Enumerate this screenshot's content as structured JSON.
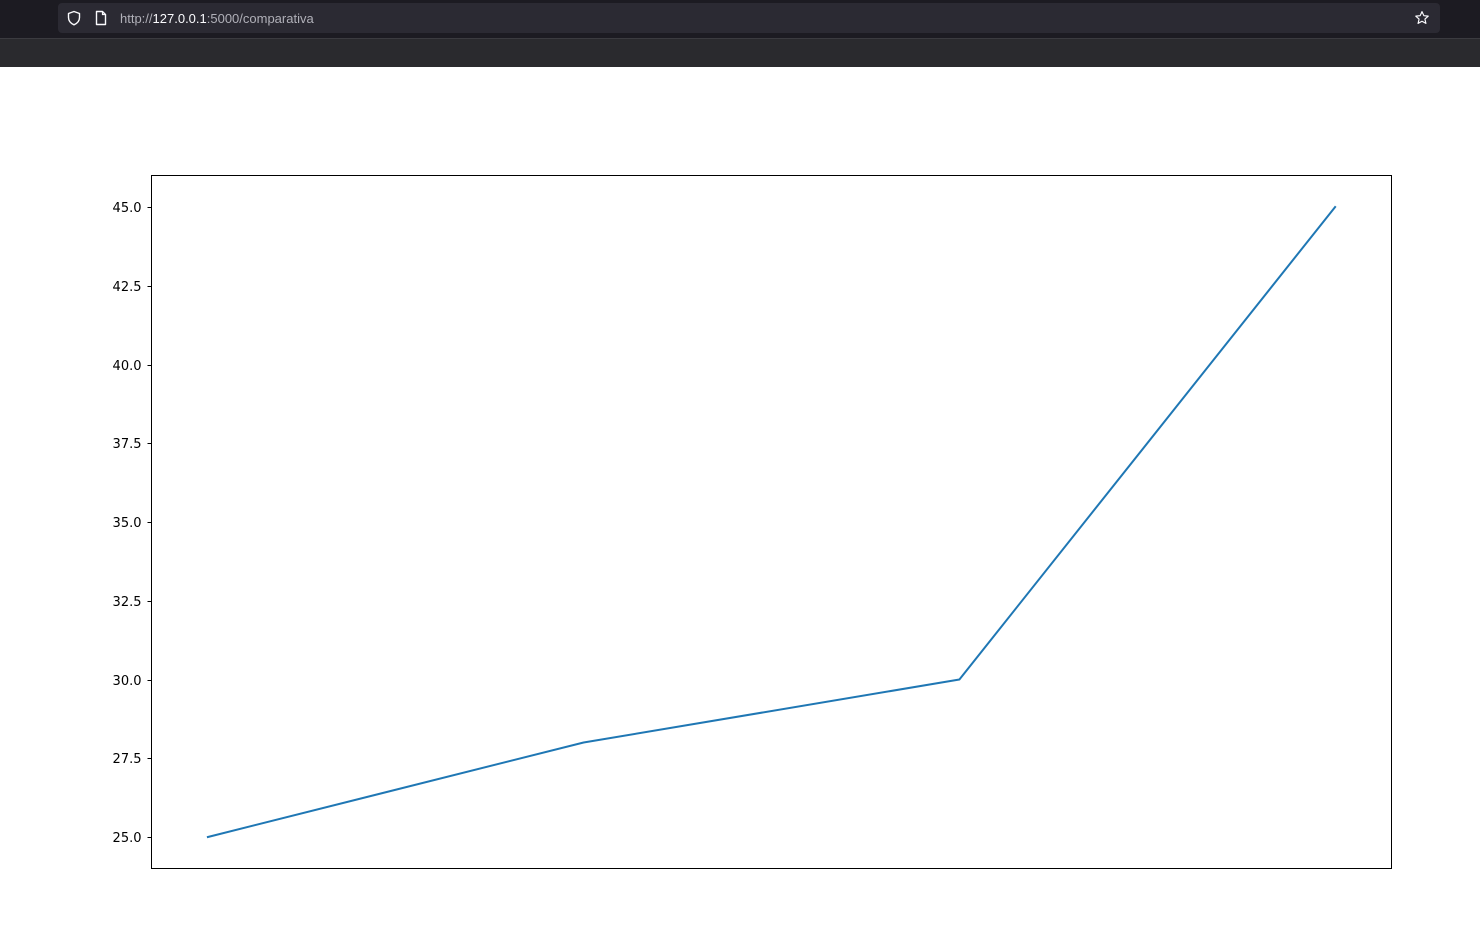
{
  "browser": {
    "url_scheme": "http://",
    "url_host": "127.0.0.1",
    "url_path": ":5000/comparativa",
    "icons": [
      "shield-icon",
      "page-icon",
      "star-icon"
    ]
  },
  "chart_data": {
    "type": "line",
    "x": [
      0,
      1,
      2,
      3
    ],
    "series": [
      {
        "values": [
          25.0,
          28.0,
          30.0,
          45.0
        ],
        "color": "#1f77b4"
      }
    ],
    "ylim": [
      24.0,
      46.0
    ],
    "yticks": [
      25.0,
      27.5,
      30.0,
      32.5,
      35.0,
      37.5,
      40.0,
      42.5,
      45.0
    ],
    "ytick_labels": [
      "25.0",
      "27.5",
      "30.0",
      "32.5",
      "35.0",
      "37.5",
      "40.0",
      "42.5",
      "45.0"
    ],
    "xticks_visible": false,
    "grid": false,
    "title": "",
    "xlabel": "",
    "ylabel": ""
  }
}
